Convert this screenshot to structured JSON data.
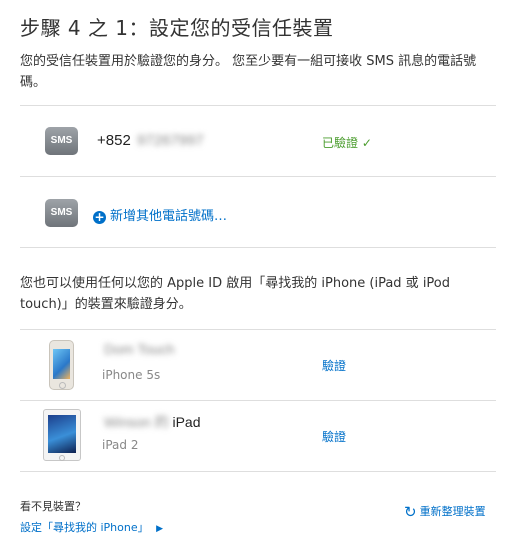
{
  "header": {
    "title": "步驟 4 之 1：設定您的受信任裝置"
  },
  "intro": "您的受信任裝置用於驗證您的身分。 您至少要有一組可接收 SMS 訊息的電話號碼。",
  "phones": [
    {
      "icon": "SMS",
      "prefix": "+852",
      "number_masked": "97267997",
      "status": "已驗證",
      "status_mark": "✓"
    }
  ],
  "add_phone": {
    "icon": "SMS",
    "label": "新增其他電話號碼…"
  },
  "find_my_note": "您也可以使用任何以您的 Apple ID 啟用「尋找我的 iPhone (iPad 或 iPod touch)」的裝置來驗證身分。",
  "devices": [
    {
      "name_blurred": "Dom Touch",
      "name_suffix": "",
      "model": "iPhone 5s",
      "action": "驗證"
    },
    {
      "name_blurred": "Winson 的",
      "name_suffix": "iPad",
      "model": "iPad 2",
      "action": "驗證"
    }
  ],
  "footer": {
    "question": "看不見裝置？",
    "setup_link": "設定「尋找我的 iPhone」",
    "refresh_label": "重新整理裝置"
  },
  "colors": {
    "link": "#0070c9",
    "verified": "#4a9c2d",
    "divider": "#dedede"
  }
}
